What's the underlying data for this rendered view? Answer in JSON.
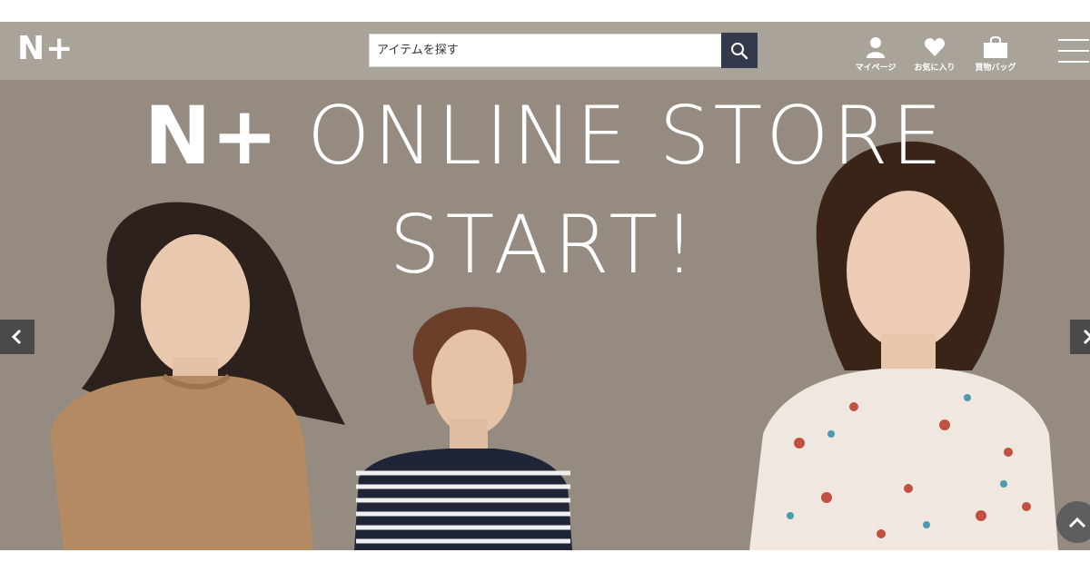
{
  "header": {
    "logo": "N+",
    "search": {
      "placeholder": "アイテムを探す",
      "value": ""
    },
    "nav": [
      {
        "label": "マイページ",
        "icon": "person-icon"
      },
      {
        "label": "お気に入り",
        "icon": "heart-icon"
      },
      {
        "label": "買物バッグ",
        "icon": "bag-icon"
      }
    ],
    "menu_icon": "hamburger-menu-icon"
  },
  "hero": {
    "title_brand": "N+",
    "title_line1": "ONLINE STORE",
    "title_line2": "START!",
    "prev_icon": "chevron-left-icon",
    "next_icon": "chevron-right-icon"
  },
  "scroll_top_icon": "chevron-up-icon",
  "colors": {
    "header_bg": "#aaa39a",
    "hero_bg": "#958b80",
    "search_button_bg": "#34394b",
    "arrow_bg": "#4a4a4a"
  }
}
